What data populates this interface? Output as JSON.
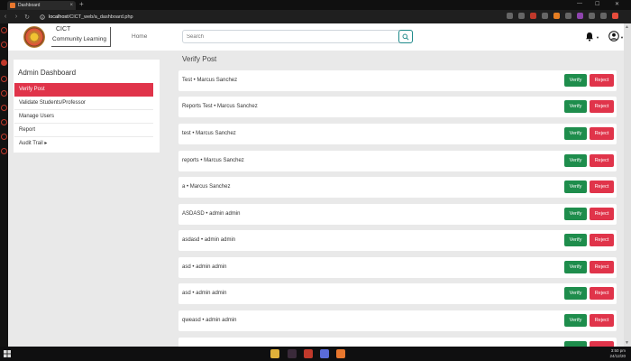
{
  "browser": {
    "tab_title": "Dashboard",
    "tab_close": "×",
    "new_tab": "+",
    "window_controls": {
      "minimize": "—",
      "maximize": "☐",
      "close": "✕"
    },
    "url_host": "localhost",
    "url_path": "/CICT_web/a_dashboard.php",
    "nav": {
      "back": "‹",
      "forward": "›",
      "reload": "↻"
    }
  },
  "header": {
    "brand_line1": "CICT",
    "brand_line2": "Community Learning",
    "nav_home": "Home",
    "search_placeholder": "Search"
  },
  "sidebar": {
    "title": "Admin Dashboard",
    "items": [
      {
        "label": "Verify Post",
        "active": true
      },
      {
        "label": "Validate Students/Professor",
        "active": false
      },
      {
        "label": "Manage Users",
        "active": false
      },
      {
        "label": "Report",
        "active": false
      },
      {
        "label": "Audit Trail ▸",
        "active": false
      }
    ]
  },
  "main": {
    "title": "Verify Post",
    "verify_label": "Verify",
    "reject_label": "Reject",
    "posts": [
      "Test • Marcus Sanchez",
      "Reports Test • Marcus Sanchez",
      "test • Marcus Sanchez",
      "reports • Marcus Sanchez",
      "a • Marcus Sanchez",
      "ASDASD • admin admin",
      "asdasd • admin admin",
      "asd • admin admin",
      "asd • admin admin",
      "qweasd • admin admin"
    ]
  },
  "taskbar": {
    "time": "3:50 pm",
    "date": "24/12/20"
  },
  "colors": {
    "accent_red": "#e0344a",
    "verify_green": "#1e8d4c"
  }
}
